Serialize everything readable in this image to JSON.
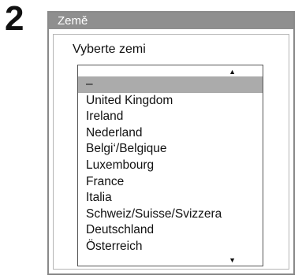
{
  "step": {
    "number": "2"
  },
  "dialog": {
    "title": "Země",
    "prompt": "Vyberte zemi"
  },
  "listbox": {
    "scroll_up_icon": "arrow-up-icon",
    "scroll_down_icon": "arrow-down-icon",
    "selected_index": 0,
    "items": [
      {
        "label": "–"
      },
      {
        "label": "United Kingdom"
      },
      {
        "label": "Ireland"
      },
      {
        "label": "Nederland"
      },
      {
        "label": "Belgi‘/Belgique"
      },
      {
        "label": "Luxembourg"
      },
      {
        "label": "France"
      },
      {
        "label": "Italia"
      },
      {
        "label": "Schweiz/Suisse/Svizzera"
      },
      {
        "label": "Deutschland"
      },
      {
        "label": "Österreich"
      }
    ]
  },
  "colors": {
    "title_bar": "#8f8f8f",
    "selection": "#ababab",
    "frame": "#8a8a8a"
  }
}
